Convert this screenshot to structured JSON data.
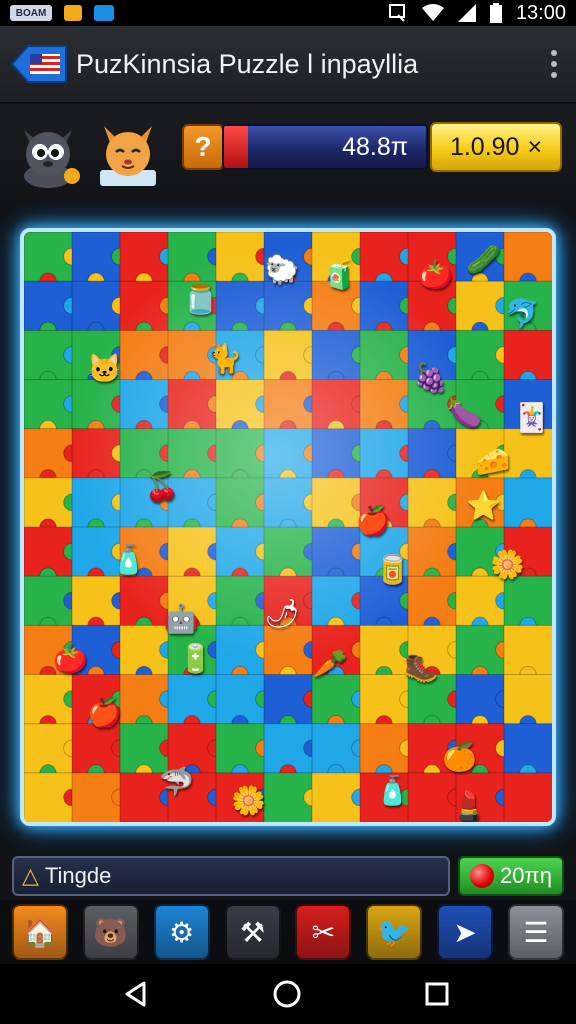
{
  "status_bar": {
    "badge_text": "BOAM",
    "time": "13:00",
    "icons": [
      "notification-icon",
      "download-icon",
      "wifi-icon",
      "signal-icon",
      "battery-icon"
    ]
  },
  "app_bar": {
    "title": "PuzKinnsia Puzzle  l inpayllia",
    "back_icon": "flag-back-icon",
    "menu_icon": "more-vert-icon"
  },
  "hud": {
    "avatars": [
      "cat-avatar-gray",
      "cat-avatar-orange"
    ],
    "help_label": "?",
    "progress_value": "48.8π",
    "progress_fill_fraction": 0.12,
    "multiplier_value": "1.0.90",
    "multiplier_close": "×"
  },
  "board": {
    "rows": 12,
    "cols": 11,
    "colors": [
      "#e8231d",
      "#1e5fd6",
      "#27b34a",
      "#f6c21a",
      "#f47d14",
      "#1fa7e8"
    ],
    "pieces": [
      {
        "name": "ghost-piece",
        "glyph": "🐑",
        "row": 0.4,
        "col": 5.0
      },
      {
        "name": "candy-piece",
        "glyph": "🧃",
        "row": 0.5,
        "col": 6.2
      },
      {
        "name": "tomato-piece",
        "glyph": "🍅",
        "row": 0.5,
        "col": 8.2
      },
      {
        "name": "cucumber-piece",
        "glyph": "🥒",
        "row": 0.2,
        "col": 9.2
      },
      {
        "name": "jar-piece",
        "glyph": "🫙",
        "row": 1.0,
        "col": 3.3
      },
      {
        "name": "fish-piece",
        "glyph": "🐬",
        "row": 1.3,
        "col": 10.0
      },
      {
        "name": "kitten-piece",
        "glyph": "🐱",
        "row": 2.4,
        "col": 1.3
      },
      {
        "name": "cat-piece",
        "glyph": "🐈",
        "row": 2.2,
        "col": 3.8
      },
      {
        "name": "plum-piece",
        "glyph": "🍇",
        "row": 2.6,
        "col": 8.1
      },
      {
        "name": "eggplant-piece",
        "glyph": "🍆",
        "row": 3.3,
        "col": 8.8
      },
      {
        "name": "card-piece",
        "glyph": "🃏",
        "row": 3.4,
        "col": 10.2
      },
      {
        "name": "cheese-piece",
        "glyph": "🧀",
        "row": 4.3,
        "col": 9.4
      },
      {
        "name": "berry-piece",
        "glyph": "🍒",
        "row": 4.8,
        "col": 2.5
      },
      {
        "name": "star-piece",
        "glyph": "⭐",
        "row": 5.2,
        "col": 9.2
      },
      {
        "name": "apple-piece",
        "glyph": "🍎",
        "row": 5.5,
        "col": 6.9
      },
      {
        "name": "bottle-piece",
        "glyph": "🧴",
        "row": 6.3,
        "col": 1.8
      },
      {
        "name": "can-piece",
        "glyph": "🥫",
        "row": 6.5,
        "col": 7.3
      },
      {
        "name": "flower-piece",
        "glyph": "🌼",
        "row": 6.4,
        "col": 9.7
      },
      {
        "name": "robot-piece",
        "glyph": "🤖",
        "row": 7.5,
        "col": 2.9
      },
      {
        "name": "chili-piece",
        "glyph": "🌶",
        "row": 7.4,
        "col": 5.0
      },
      {
        "name": "tomato-piece-2",
        "glyph": "🍅",
        "row": 8.3,
        "col": 0.6
      },
      {
        "name": "battery-piece",
        "glyph": "🔋",
        "row": 8.3,
        "col": 3.2
      },
      {
        "name": "carrot-piece",
        "glyph": "🥕",
        "row": 8.4,
        "col": 6.0
      },
      {
        "name": "boots-piece",
        "glyph": "🥾",
        "row": 8.5,
        "col": 7.9
      },
      {
        "name": "apple-piece-2",
        "glyph": "🍎",
        "row": 9.4,
        "col": 1.3
      },
      {
        "name": "orange-piece",
        "glyph": "🍊",
        "row": 10.3,
        "col": 8.7
      },
      {
        "name": "shark-piece",
        "glyph": "🦈",
        "row": 10.8,
        "col": 2.8
      },
      {
        "name": "daisy-piece",
        "glyph": "🌼",
        "row": 11.2,
        "col": 4.3
      },
      {
        "name": "bottle-piece-2",
        "glyph": "🧴",
        "row": 11.0,
        "col": 7.3
      },
      {
        "name": "lipstick-piece",
        "glyph": "💄",
        "row": 11.3,
        "col": 8.9
      }
    ]
  },
  "hint": {
    "text": "Tingde",
    "icon": "pyramid-icon"
  },
  "coins": {
    "value": "20πη"
  },
  "toolbar": {
    "items": [
      {
        "name": "home-button",
        "icon": "home-icon",
        "glyph": "🏠",
        "color": "#f48a1e"
      },
      {
        "name": "profile-button",
        "icon": "bear-icon",
        "glyph": "🐻",
        "color": "#5c5f66"
      },
      {
        "name": "settings-button",
        "icon": "gear-icon",
        "glyph": "⚙",
        "color": "#1d84d6"
      },
      {
        "name": "tools-button",
        "icon": "wrench-icon",
        "glyph": "⚒",
        "color": "#3a3d48"
      },
      {
        "name": "shop-button",
        "icon": "scissors-icon",
        "glyph": "✂",
        "color": "#d61e1e"
      },
      {
        "name": "rewards-button",
        "icon": "bird-icon",
        "glyph": "🐦",
        "color": "#d9a614"
      },
      {
        "name": "share-button",
        "icon": "send-icon",
        "glyph": "➤",
        "color": "#1f4fb8"
      },
      {
        "name": "menu-button",
        "icon": "menu-icon",
        "glyph": "☰",
        "color": "#8d9098"
      }
    ]
  },
  "nav": {
    "icons": [
      "back-triangle-icon",
      "home-circle-icon",
      "recents-square-icon"
    ]
  }
}
